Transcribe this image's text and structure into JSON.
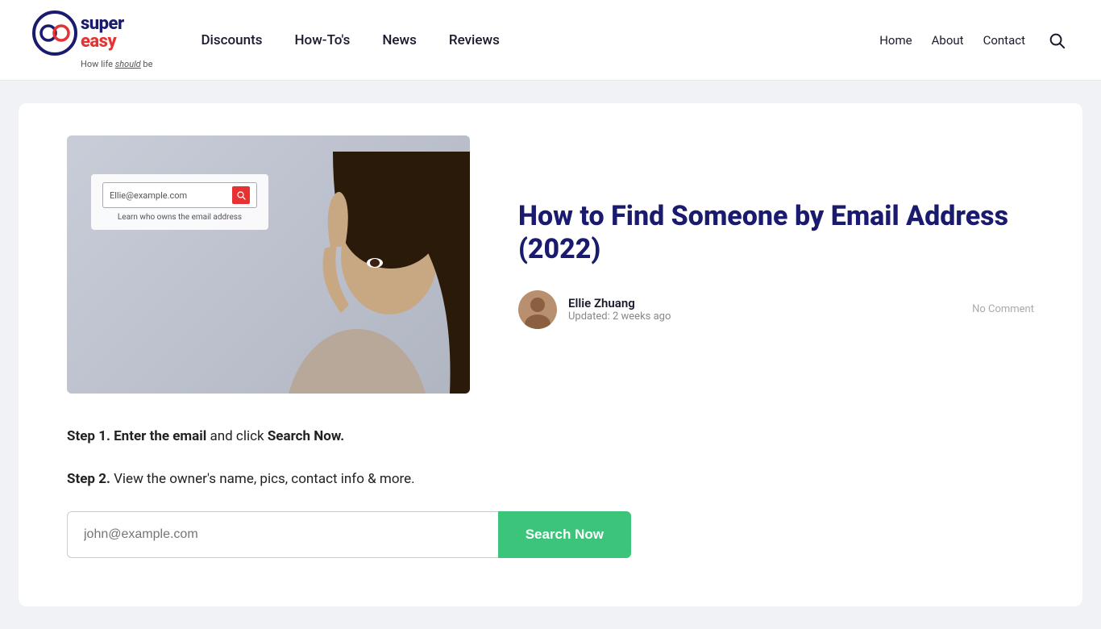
{
  "header": {
    "logo": {
      "super_text": "super",
      "easy_text": "easy",
      "tagline_normal": "How life ",
      "tagline_italic": "should",
      "tagline_end": " be"
    },
    "nav": {
      "items": [
        {
          "label": "Discounts",
          "href": "#"
        },
        {
          "label": "How-To's",
          "href": "#"
        },
        {
          "label": "News",
          "href": "#"
        },
        {
          "label": "Reviews",
          "href": "#"
        }
      ]
    },
    "right_nav": {
      "items": [
        {
          "label": "Home",
          "href": "#"
        },
        {
          "label": "About",
          "href": "#"
        },
        {
          "label": "Contact",
          "href": "#"
        }
      ]
    }
  },
  "article": {
    "title": "How to Find Someone by Email Address (2022)",
    "author": {
      "name": "Ellie Zhuang",
      "updated": "Updated: 2 weeks ago"
    },
    "no_comment": "No Comment",
    "hero_search": {
      "placeholder": "Ellie@example.com",
      "caption": "Learn who owns the email address"
    },
    "step1_prefix": "Step 1. ",
    "step1_bold": "Enter the email",
    "step1_middle": " and click ",
    "step1_bold2": "Search Now.",
    "step2_prefix": "Step 2. ",
    "step2_text": "View the owner's name, pics, contact info & more.",
    "search_input_placeholder": "john@example.com",
    "search_button_label": "Search Now"
  }
}
